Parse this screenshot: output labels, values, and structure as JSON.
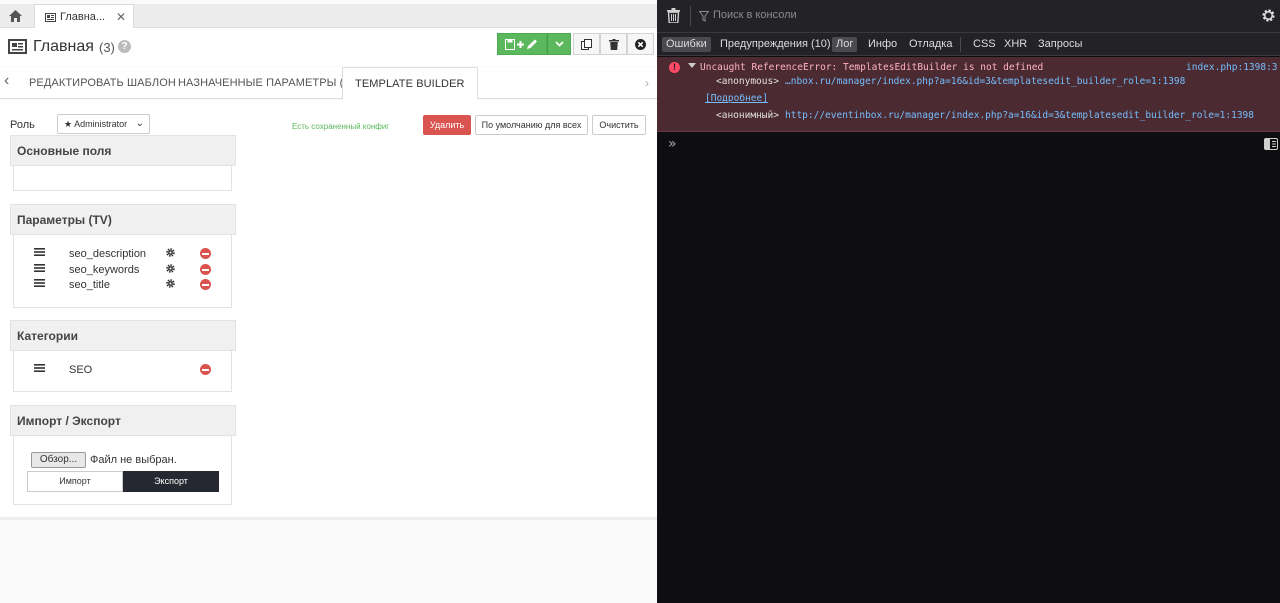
{
  "tabbar": {
    "doc_tab_label": "Главна...",
    "close": "✕"
  },
  "header": {
    "title": "Главная",
    "count": "(3)",
    "help": "?"
  },
  "toolbar": {
    "dropdown": "⌄"
  },
  "tabs": {
    "edit_template": "РЕДАКТИРОВАТЬ ШАБЛОН",
    "assigned_params": "НАЗНАЧЕННЫЕ ПАРАМЕТРЫ (TV)",
    "template_builder": "TEMPLATE BUILDER",
    "prev": "‹",
    "next": "›"
  },
  "builder": {
    "role_label": "Роль",
    "role_value": "★ Administrator",
    "saved_config": "Есть сохраненный конфиг",
    "delete_label": "Удалить",
    "default_label": "По умолчанию для всех",
    "clear_label": "Очистить",
    "panels": {
      "main_fields": {
        "title": "Основные поля"
      },
      "params": {
        "title": "Параметры (TV)",
        "items": [
          {
            "label": "seo_description"
          },
          {
            "label": "seo_keywords"
          },
          {
            "label": "seo_title"
          }
        ]
      },
      "categories": {
        "title": "Категории",
        "items": [
          {
            "label": "SEO"
          }
        ]
      },
      "import_export": {
        "title": "Импорт / Экспорт",
        "browse_label": "Обзор...",
        "file_status": "Файл не выбран.",
        "import_label": "Импорт",
        "export_label": "Экспорт"
      }
    }
  },
  "devtools": {
    "filter_placeholder": "Поиск в консоли",
    "filters": {
      "errors": "Ошибки",
      "warnings": "Предупреждения (10)",
      "log": "Лог",
      "info": "Инфо",
      "debug": "Отладка",
      "css": "CSS",
      "xhr": "XHR",
      "requests": "Запросы"
    },
    "error": {
      "message": "Uncaught ReferenceError: TemplatesEditBuilder is not defined",
      "source": "index.php:1398:3",
      "stack": [
        {
          "name": "<anonymous>",
          "location": "…nbox.ru/manager/index.php?a=16&id=3&templatesedit_builder_role=1:1398"
        },
        {
          "name": "<анонимный>",
          "location": "http://eventinbox.ru/manager/index.php?a=16&id=3&templatesedit_builder_role=1:1398"
        }
      ],
      "more": "[Подробнее]"
    },
    "prompt": "»"
  },
  "colors": {
    "save_green": "#5cb85c",
    "delete_red": "#d9534f",
    "error_bg": "#4b2a31",
    "link_blue": "#75bfff"
  }
}
